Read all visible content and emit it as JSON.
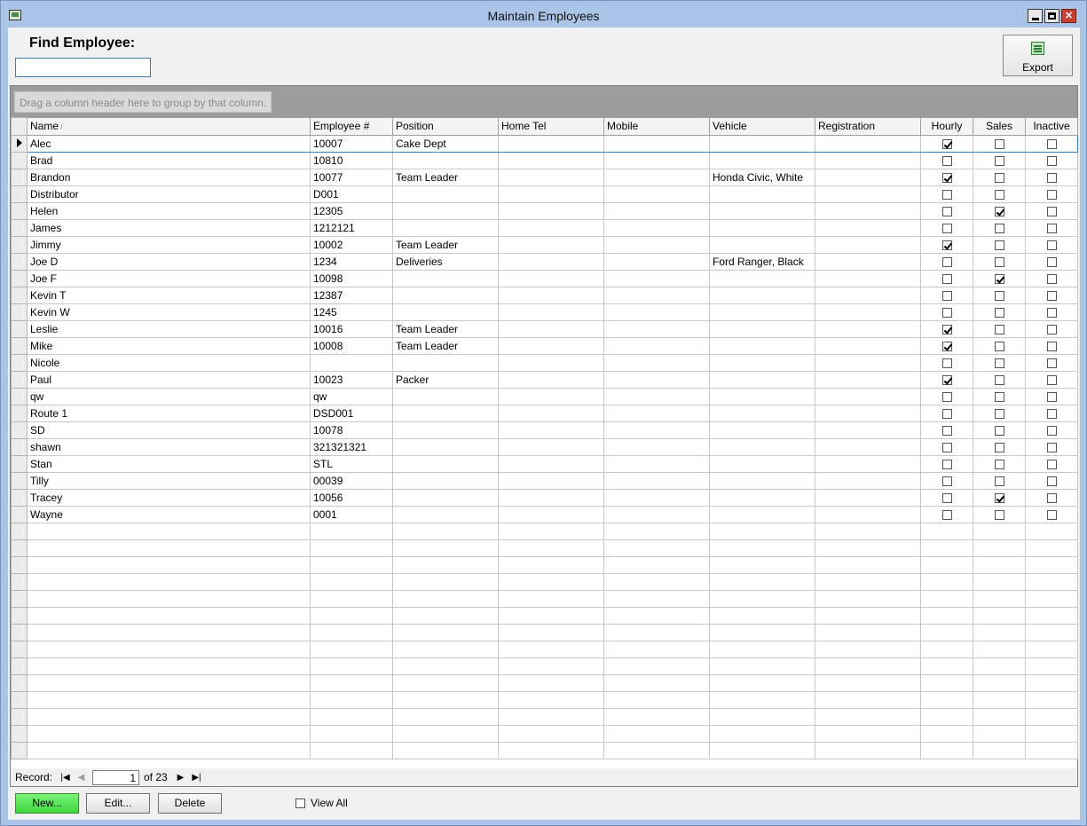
{
  "window": {
    "title": "Maintain Employees"
  },
  "find": {
    "label": "Find Employee:",
    "value": ""
  },
  "toolbar": {
    "export_label": "Export"
  },
  "grid": {
    "group_hint": "Drag a column header here to group by that column.",
    "columns": [
      "Name",
      "Employee #",
      "Position",
      "Home Tel",
      "Mobile",
      "Vehicle",
      "Registration",
      "Hourly",
      "Sales",
      "Inactive"
    ],
    "sort_indicator": "/",
    "rows": [
      {
        "name": "Alec",
        "emp": "10007",
        "position": "Cake Dept",
        "home": "",
        "mobile": "",
        "vehicle": "",
        "reg": "",
        "hourly": true,
        "sales": false,
        "inactive": false
      },
      {
        "name": "Brad",
        "emp": "10810",
        "position": "",
        "home": "",
        "mobile": "",
        "vehicle": "",
        "reg": "",
        "hourly": false,
        "sales": false,
        "inactive": false
      },
      {
        "name": "Brandon",
        "emp": "10077",
        "position": "Team Leader",
        "home": "",
        "mobile": "",
        "vehicle": "Honda Civic, White",
        "reg": "",
        "hourly": true,
        "sales": false,
        "inactive": false
      },
      {
        "name": "Distributor",
        "emp": "D001",
        "position": "",
        "home": "",
        "mobile": "",
        "vehicle": "",
        "reg": "",
        "hourly": false,
        "sales": false,
        "inactive": false
      },
      {
        "name": "Helen",
        "emp": "12305",
        "position": "",
        "home": "",
        "mobile": "",
        "vehicle": "",
        "reg": "",
        "hourly": false,
        "sales": true,
        "inactive": false
      },
      {
        "name": "James",
        "emp": "1212121",
        "position": "",
        "home": "",
        "mobile": "",
        "vehicle": "",
        "reg": "",
        "hourly": false,
        "sales": false,
        "inactive": false
      },
      {
        "name": "Jimmy",
        "emp": "10002",
        "position": "Team Leader",
        "home": "",
        "mobile": "",
        "vehicle": "",
        "reg": "",
        "hourly": true,
        "sales": false,
        "inactive": false
      },
      {
        "name": "Joe D",
        "emp": "1234",
        "position": "Deliveries",
        "home": "",
        "mobile": "",
        "vehicle": "Ford Ranger, Black",
        "reg": "",
        "hourly": false,
        "sales": false,
        "inactive": false
      },
      {
        "name": "Joe F",
        "emp": "10098",
        "position": "",
        "home": "",
        "mobile": "",
        "vehicle": "",
        "reg": "",
        "hourly": false,
        "sales": true,
        "inactive": false
      },
      {
        "name": "Kevin T",
        "emp": "12387",
        "position": "",
        "home": "",
        "mobile": "",
        "vehicle": "",
        "reg": "",
        "hourly": false,
        "sales": false,
        "inactive": false
      },
      {
        "name": "Kevin W",
        "emp": "1245",
        "position": "",
        "home": "",
        "mobile": "",
        "vehicle": "",
        "reg": "",
        "hourly": false,
        "sales": false,
        "inactive": false
      },
      {
        "name": "Leslie",
        "emp": "10016",
        "position": "Team Leader",
        "home": "",
        "mobile": "",
        "vehicle": "",
        "reg": "",
        "hourly": true,
        "sales": false,
        "inactive": false
      },
      {
        "name": "Mike",
        "emp": "10008",
        "position": "Team Leader",
        "home": "",
        "mobile": "",
        "vehicle": "",
        "reg": "",
        "hourly": true,
        "sales": false,
        "inactive": false
      },
      {
        "name": "Nicole",
        "emp": "",
        "position": "",
        "home": "",
        "mobile": "",
        "vehicle": "",
        "reg": "",
        "hourly": false,
        "sales": false,
        "inactive": false
      },
      {
        "name": "Paul",
        "emp": "10023",
        "position": "Packer",
        "home": "",
        "mobile": "",
        "vehicle": "",
        "reg": "",
        "hourly": true,
        "sales": false,
        "inactive": false
      },
      {
        "name": "qw",
        "emp": "qw",
        "position": "",
        "home": "",
        "mobile": "",
        "vehicle": "",
        "reg": "",
        "hourly": false,
        "sales": false,
        "inactive": false
      },
      {
        "name": "Route 1",
        "emp": "DSD001",
        "position": "",
        "home": "",
        "mobile": "",
        "vehicle": "",
        "reg": "",
        "hourly": false,
        "sales": false,
        "inactive": false
      },
      {
        "name": "SD",
        "emp": "10078",
        "position": "",
        "home": "",
        "mobile": "",
        "vehicle": "",
        "reg": "",
        "hourly": false,
        "sales": false,
        "inactive": false
      },
      {
        "name": "shawn",
        "emp": "321321321",
        "position": "",
        "home": "",
        "mobile": "",
        "vehicle": "",
        "reg": "",
        "hourly": false,
        "sales": false,
        "inactive": false
      },
      {
        "name": "Stan",
        "emp": "STL",
        "position": "",
        "home": "",
        "mobile": "",
        "vehicle": "",
        "reg": "",
        "hourly": false,
        "sales": false,
        "inactive": false
      },
      {
        "name": "Tilly",
        "emp": "00039",
        "position": "",
        "home": "",
        "mobile": "",
        "vehicle": "",
        "reg": "",
        "hourly": false,
        "sales": false,
        "inactive": false
      },
      {
        "name": "Tracey",
        "emp": "10056",
        "position": "",
        "home": "",
        "mobile": "",
        "vehicle": "",
        "reg": "",
        "hourly": false,
        "sales": true,
        "inactive": false
      },
      {
        "name": "Wayne",
        "emp": "0001",
        "position": "",
        "home": "",
        "mobile": "",
        "vehicle": "",
        "reg": "",
        "hourly": false,
        "sales": false,
        "inactive": false
      }
    ],
    "current_row": 0
  },
  "navigator": {
    "record_label": "Record:",
    "current": "1",
    "of_label": "of 23"
  },
  "buttons": {
    "new_label": "New...",
    "edit_label": "Edit...",
    "delete_label": "Delete"
  },
  "view_all": {
    "label": "View All",
    "checked": false
  },
  "colors": {
    "new_button": "#3fd83f",
    "titlebar": "#a9c4e6",
    "close_button": "#c7402f"
  },
  "icons": {
    "app": "app-window-icon",
    "export": "spreadsheet-export-icon"
  }
}
